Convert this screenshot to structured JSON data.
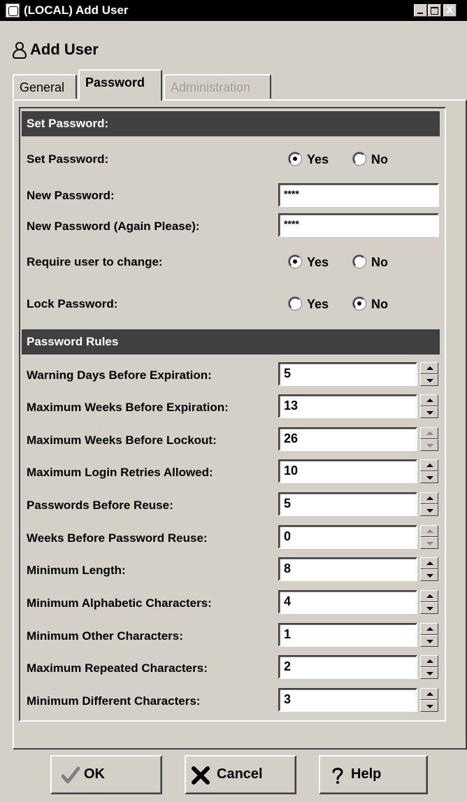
{
  "window": {
    "title": "(LOCAL) Add User",
    "close_glyph": "X"
  },
  "header": {
    "title": "Add User",
    "icon": "user-icon"
  },
  "tabs": [
    {
      "label": "General",
      "state": "inactive"
    },
    {
      "label": "Password",
      "state": "active"
    },
    {
      "label": "Administration",
      "state": "disabled"
    }
  ],
  "set_password": {
    "section_title": "Set Password:",
    "set_password": {
      "label": "Set Password:",
      "yes_label": "Yes",
      "no_label": "No",
      "selected": "Yes"
    },
    "new_password": {
      "label": "New Password:",
      "value": "****"
    },
    "new_password_again": {
      "label": "New Password (Again Please):",
      "value": "****"
    },
    "require_change": {
      "label": "Require user to change:",
      "yes_label": "Yes",
      "no_label": "No",
      "selected": "Yes"
    },
    "lock_password": {
      "label": "Lock Password:",
      "yes_label": "Yes",
      "no_label": "No",
      "selected": "No"
    }
  },
  "rules": {
    "section_title": "Password Rules",
    "items": [
      {
        "label": "Warning Days Before Expiration:",
        "value": "5"
      },
      {
        "label": "Maximum Weeks Before Expiration:",
        "value": "13"
      },
      {
        "label": "Maximum Weeks Before Lockout:",
        "value": "26"
      },
      {
        "label": "Maximum Login Retries Allowed:",
        "value": "10"
      },
      {
        "label": "Passwords Before Reuse:",
        "value": "5"
      },
      {
        "label": "Weeks Before Password Reuse:",
        "value": "0"
      },
      {
        "label": "Minimum Length:",
        "value": "8"
      },
      {
        "label": "Minimum Alphabetic Characters:",
        "value": "4"
      },
      {
        "label": "Minimum Other Characters:",
        "value": "1"
      },
      {
        "label": "Maximum Repeated Characters:",
        "value": "2"
      },
      {
        "label": "Minimum Different Characters:",
        "value": "3"
      }
    ]
  },
  "buttons": {
    "ok": "OK",
    "cancel": "Cancel",
    "help": "Help"
  },
  "colors": {
    "titlebar": "#000000",
    "section_bar": "#404040",
    "window_bg": "#d4d0c8"
  }
}
